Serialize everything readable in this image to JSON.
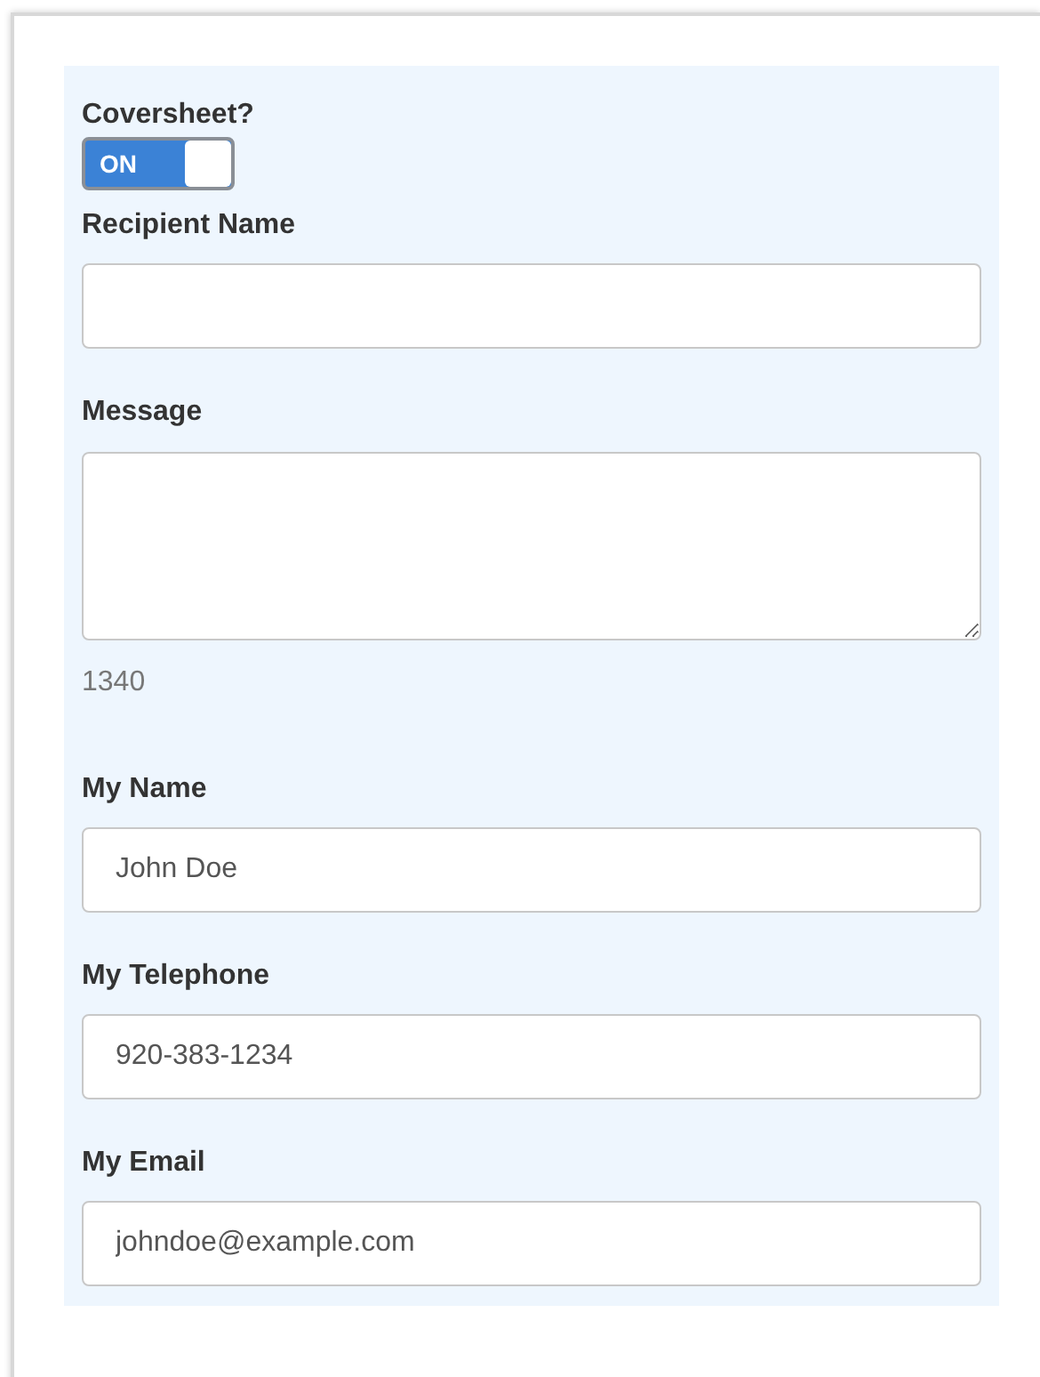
{
  "fields": [
    {
      "kind": "toggle",
      "label": "Coversheet?",
      "on": true,
      "on_text": "ON"
    },
    {
      "kind": "text",
      "label": "Recipient Name"
    },
    {
      "kind": "textarea",
      "label": "Message",
      "counter": "1340"
    },
    {
      "kind": "text",
      "label": "My Name",
      "value": "John Doe"
    },
    {
      "kind": "text",
      "label": "My Telephone",
      "value": "920-383-1234"
    },
    {
      "kind": "text",
      "label": "My Email",
      "value": "johndoe@example.com"
    }
  ]
}
